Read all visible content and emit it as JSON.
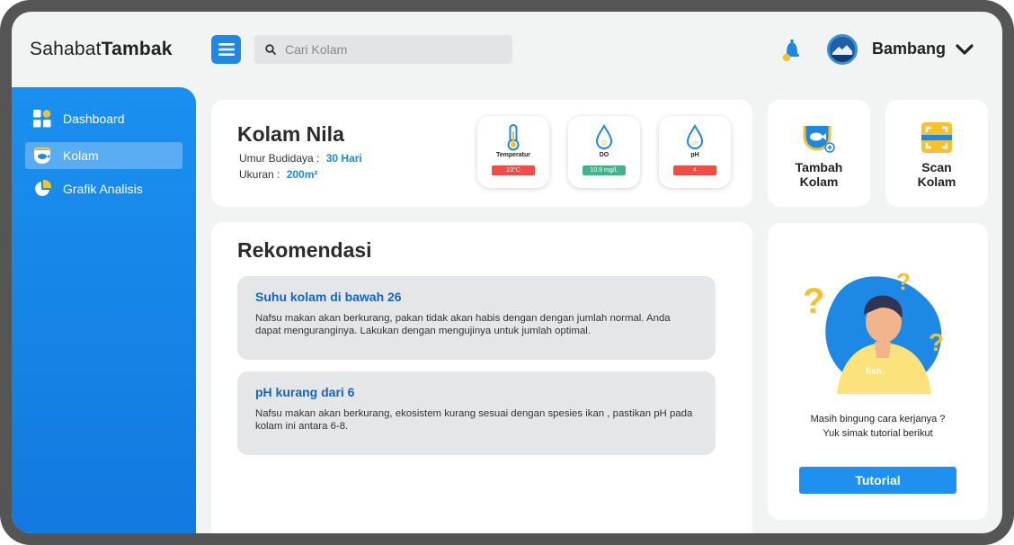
{
  "brand": {
    "light": "Sahabat",
    "bold": "Tambak"
  },
  "search": {
    "placeholder": "Cari Kolam"
  },
  "user": {
    "name": "Bambang"
  },
  "sidebar": {
    "items": [
      {
        "label": "Dashboard",
        "icon": "dashboard-grid-icon"
      },
      {
        "label": "Kolam",
        "icon": "pond-fish-icon",
        "active": true
      },
      {
        "label": "Grafik Analisis",
        "icon": "pie-chart-icon"
      }
    ]
  },
  "pond": {
    "title": "Kolam Nila",
    "age_label": "Umur Budidaya :",
    "age_value": "30 Hari",
    "size_label": "Ukuran :",
    "size_value": "200m²"
  },
  "sensors": [
    {
      "label": "Temperatur",
      "value": "23°C",
      "color": "#ef4d45",
      "icon": "thermometer-icon"
    },
    {
      "label": "DO",
      "value": "10.9 mg/L",
      "color": "#3fb58a",
      "icon": "water-drop-o-icon"
    },
    {
      "label": "pH",
      "value": "4",
      "color": "#ef4d45",
      "icon": "water-drop-ph-icon"
    }
  ],
  "actions": {
    "add_pond": {
      "line1": "Tambah",
      "line2": "Kolam"
    },
    "scan_pond": {
      "line1": "Scan",
      "line2": "Kolam"
    }
  },
  "recommendations": {
    "title": "Rekomendasi",
    "items": [
      {
        "heading": "Suhu kolam di bawah 26",
        "body": "Nafsu makan akan berkurang, pakan tidak akan habis dengan dengan jumlah normal. Anda dapat menguranginya. Lakukan dengan mengujinya untuk jumlah optimal."
      },
      {
        "heading": "pH kurang dari 6",
        "body": "Nafsu makan akan berkurang, ekosistem kurang sesuai dengan spesies ikan , pastikan pH pada kolam ini antara 6-8."
      }
    ]
  },
  "help": {
    "line1": "Masih bingung cara kerjanya ?",
    "line2": "Yuk simak tutorial berikut",
    "button": "Tutorial",
    "shirt_text": "fish."
  },
  "colors": {
    "primary": "#1e88e5",
    "accent_yellow": "#f6c12f",
    "danger": "#ef4d45",
    "success": "#3fb58a"
  }
}
